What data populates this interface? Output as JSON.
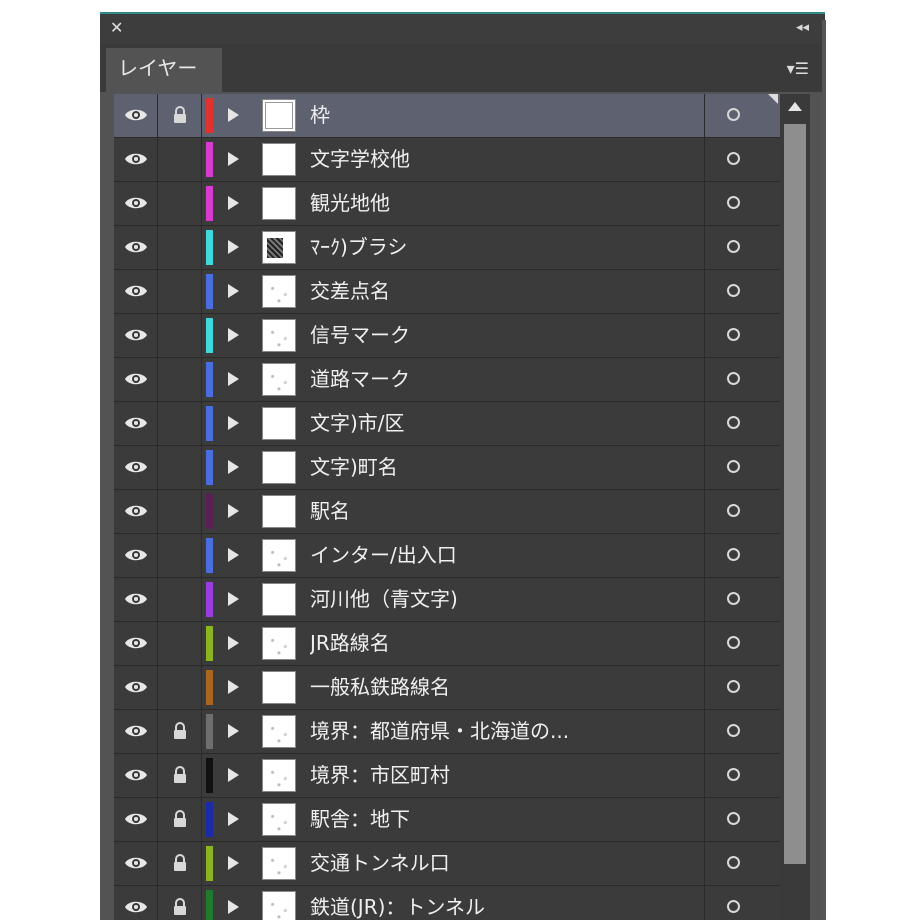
{
  "window": {
    "close_glyph": "✕",
    "collapse_glyph": "◂◂"
  },
  "panel": {
    "tab_label": "レイヤー",
    "menu_glyph": "▾☰"
  },
  "icons": {
    "visibility": "eye-icon",
    "lock": "lock-icon",
    "expand": "triangle-right-icon",
    "target": "circle-target-icon"
  },
  "layers": [
    {
      "name": "枠",
      "color": "#e0322e",
      "locked": true,
      "selected": true,
      "thumb": "frame"
    },
    {
      "name": "文字学校他",
      "color": "#d93ad0",
      "locked": false,
      "selected": false,
      "thumb": "blank"
    },
    {
      "name": "観光地他",
      "color": "#d93ad0",
      "locked": false,
      "selected": false,
      "thumb": "blank"
    },
    {
      "name": "ﾏｰｸ)ブラシ",
      "color": "#3fd9d9",
      "locked": false,
      "selected": false,
      "thumb": "dark"
    },
    {
      "name": "交差点名",
      "color": "#4a6ee0",
      "locked": false,
      "selected": false,
      "thumb": "speck"
    },
    {
      "name": "信号マーク",
      "color": "#3fd9d9",
      "locked": false,
      "selected": false,
      "thumb": "speck"
    },
    {
      "name": "道路マーク",
      "color": "#4a6ee0",
      "locked": false,
      "selected": false,
      "thumb": "speck"
    },
    {
      "name": "文字)市/区",
      "color": "#4a6ee0",
      "locked": false,
      "selected": false,
      "thumb": "blank"
    },
    {
      "name": "文字)町名",
      "color": "#4a6ee0",
      "locked": false,
      "selected": false,
      "thumb": "blank"
    },
    {
      "name": "駅名",
      "color": "#5a1f55",
      "locked": false,
      "selected": false,
      "thumb": "blank"
    },
    {
      "name": "インター/出入口",
      "color": "#4a6ee0",
      "locked": false,
      "selected": false,
      "thumb": "speck"
    },
    {
      "name": "河川他（青文字)",
      "color": "#9a3de0",
      "locked": false,
      "selected": false,
      "thumb": "blank"
    },
    {
      "name": "JR路線名",
      "color": "#8ab51e",
      "locked": false,
      "selected": false,
      "thumb": "speck"
    },
    {
      "name": "一般私鉄路線名",
      "color": "#a8661e",
      "locked": false,
      "selected": false,
      "thumb": "blank"
    },
    {
      "name": "境界：都道府県・北海道の...",
      "color": "#6e6e6e",
      "locked": true,
      "selected": false,
      "thumb": "speck"
    },
    {
      "name": "境界：市区町村",
      "color": "#111111",
      "locked": true,
      "selected": false,
      "thumb": "speck"
    },
    {
      "name": "駅舎：地下",
      "color": "#1a2aa8",
      "locked": true,
      "selected": false,
      "thumb": "speck"
    },
    {
      "name": "交通トンネル口",
      "color": "#8ab51e",
      "locked": true,
      "selected": false,
      "thumb": "speck"
    },
    {
      "name": "鉄道(JR)：トンネル",
      "color": "#1f7a2e",
      "locked": true,
      "selected": false,
      "thumb": "speck"
    }
  ]
}
